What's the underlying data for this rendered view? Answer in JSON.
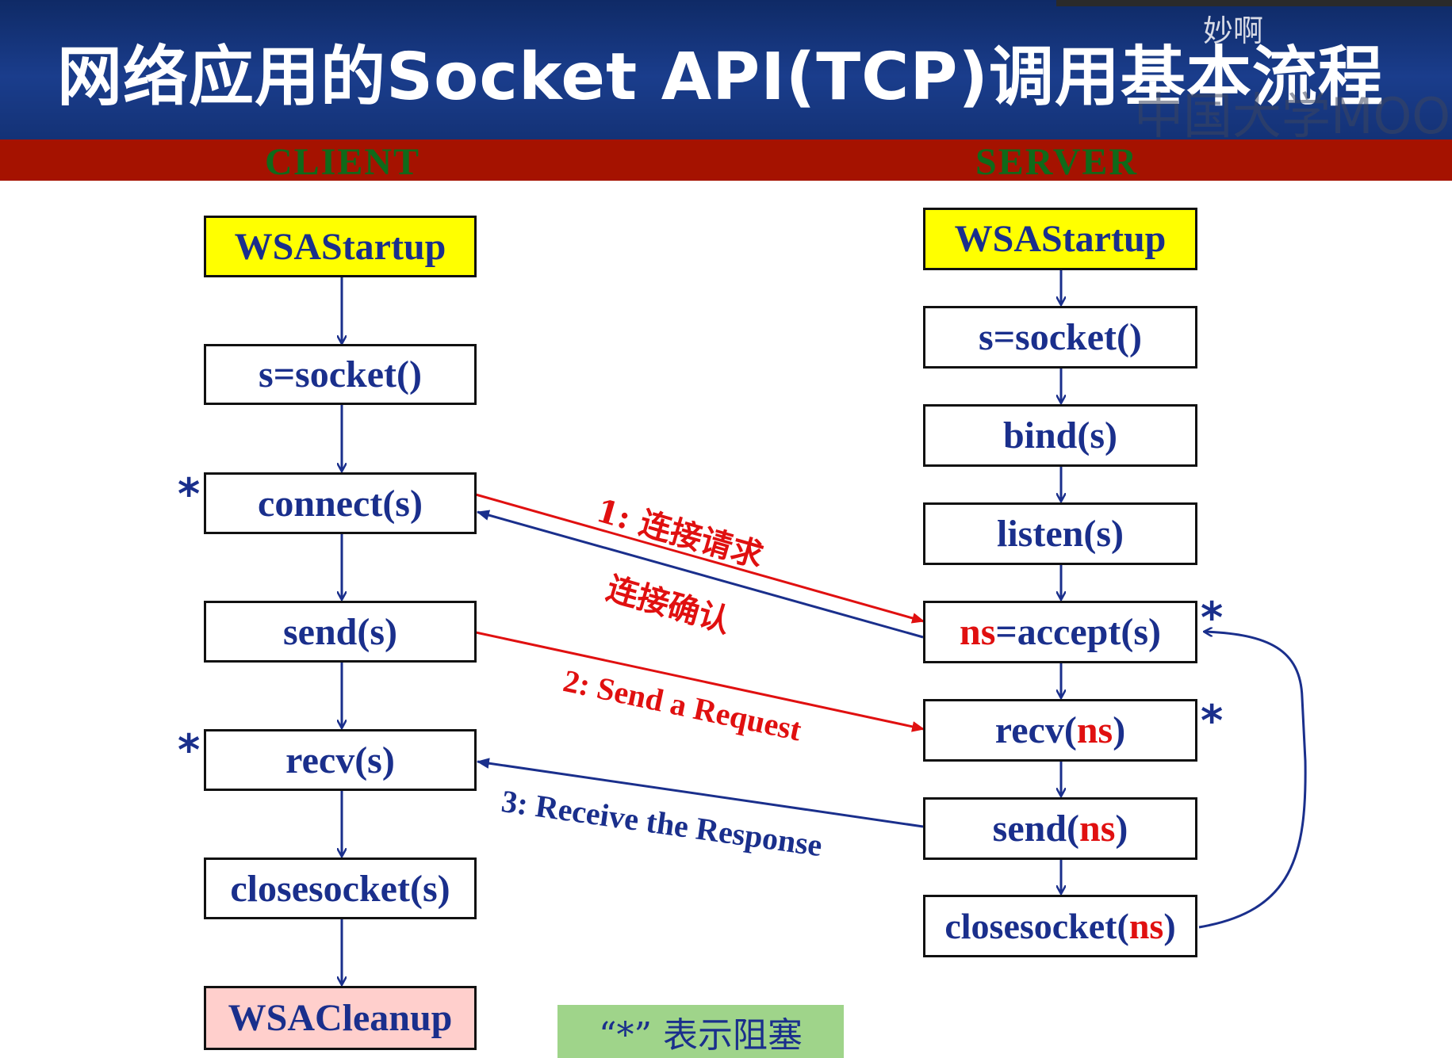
{
  "title": "网络应用的Socket API(TCP)调用基本流程",
  "watermark": {
    "user": "妙啊",
    "brand": "中国大学MOOC"
  },
  "roles": {
    "client": "CLIENT",
    "server": "SERVER"
  },
  "client_steps": [
    {
      "label": "WSAStartup"
    },
    {
      "label": "s=socket()"
    },
    {
      "label": "connect(s)",
      "blocking": true
    },
    {
      "label": "send(s)"
    },
    {
      "label": "recv(s)",
      "blocking": true
    },
    {
      "label": "closesocket(s)"
    },
    {
      "label": "WSACleanup"
    }
  ],
  "server_steps": [
    {
      "label": "WSAStartup"
    },
    {
      "label": "s=socket()"
    },
    {
      "label": "bind(s)"
    },
    {
      "label": "listen(s)"
    },
    {
      "label_red": "ns",
      "label": "=accept(s)",
      "blocking": true
    },
    {
      "label": "recv(",
      "label_red": "ns",
      "label_end": ")",
      "blocking": true
    },
    {
      "label": "send(",
      "label_red": "ns",
      "label_end": ")"
    },
    {
      "label": "closesocket(",
      "label_red": "ns",
      "label_end": ")"
    }
  ],
  "messages": {
    "connect_request": "1:  连接请求",
    "connect_ack": "连接确认",
    "send_request": "2: Send a Request",
    "receive_response": "3: Receive the Response"
  },
  "blocking_marker": "*",
  "note": "“*”  表示阻塞",
  "colors": {
    "title_bg": "#1a3d8c",
    "role_band": "#a51200",
    "role_text": "#0f6a1a",
    "box_text": "#1a2f8c",
    "highlight_red": "#e01010",
    "start_box": "#ffff00",
    "cleanup_box": "#ffcfcc",
    "note_bg": "#9fd48a"
  }
}
